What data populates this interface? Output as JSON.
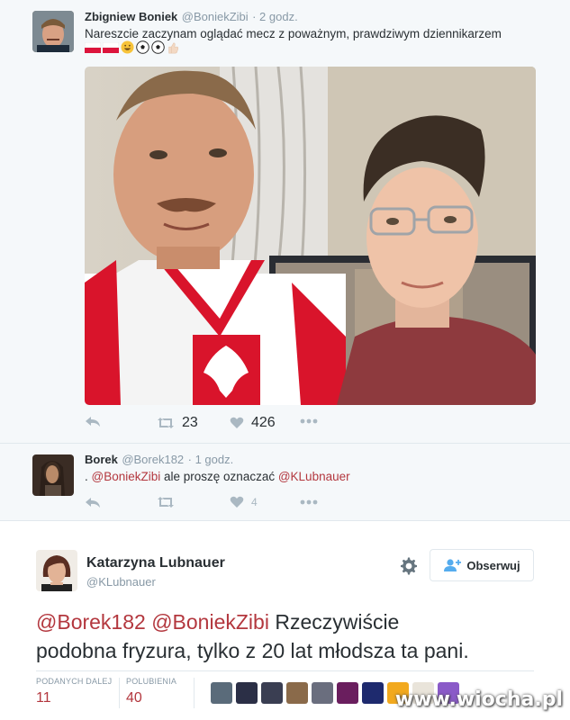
{
  "tweet1": {
    "name": "Zbigniew Boniek",
    "handle": "@BoniekZibi",
    "time": "· 2 godz.",
    "text": "Nareszcie zaczynam oglądać mecz z poważnym, prawdziwym dziennikarzem",
    "emoji_line": [
      "flag-poland",
      "flag-poland",
      "grin-emoji",
      "soccer-ball",
      "soccer-ball",
      "thumbs-up"
    ],
    "retweets": "23",
    "likes": "426"
  },
  "tweet2": {
    "name": "Borek",
    "handle": "@Borek182",
    "time": "· 1 godz.",
    "text_prefix": ". ",
    "mention1": "@BoniekZibi",
    "text_middle": " ale proszę oznaczać ",
    "mention2": "@KLubnauer",
    "likes": "4"
  },
  "tweet3": {
    "name": "Katarzyna Lubnauer",
    "handle": "@KLubnauer",
    "follow_label": "Obserwuj",
    "mention1": "@Borek182",
    "mention2": "@BoniekZibi",
    "text_line1_rest": " Rzeczywiście",
    "text_line2": "podobna fryzura, tylko z 20 lat młodsza ta pani.",
    "retweets_label": "PODANYCH DALEJ",
    "retweets_value": "11",
    "likes_label": "POLUBIENIA",
    "likes_value": "40"
  },
  "colors": {
    "mention": "#b3373e",
    "muted": "#8899a6",
    "icon": "#aab8c2"
  },
  "watermark": "www.wiocha.pl"
}
